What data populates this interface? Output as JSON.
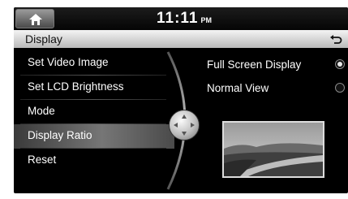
{
  "statusbar": {
    "home_icon": "home-icon",
    "time": "11:11",
    "ampm": "PM"
  },
  "titlebar": {
    "title": "Display",
    "back_icon": "back-arrow-icon"
  },
  "menu": {
    "items": [
      {
        "label": "Set Video Image"
      },
      {
        "label": "Set LCD Brightness"
      },
      {
        "label": "Mode"
      },
      {
        "label": "Display Ratio"
      },
      {
        "label": "Reset"
      }
    ],
    "selected_index": 3
  },
  "options": {
    "items": [
      {
        "label": "Full Screen Display",
        "checked": true
      },
      {
        "label": "Normal View",
        "checked": false
      }
    ]
  },
  "colors": {
    "background": "#000000",
    "titlebar": "#d6d6d6",
    "selected_item": "#6e6e6e"
  }
}
